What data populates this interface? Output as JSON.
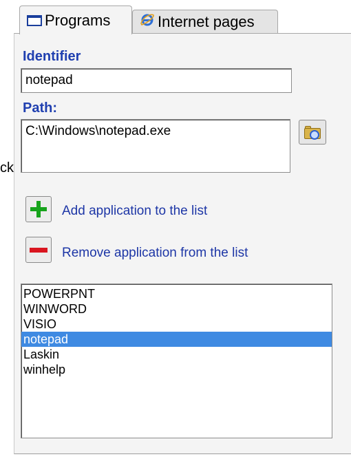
{
  "stray_text": "ck",
  "tabs": [
    {
      "label": "Programs",
      "icon": "window-icon",
      "selected": true
    },
    {
      "label": "Internet pages",
      "icon": "internet-explorer-icon",
      "selected": false
    }
  ],
  "identifier": {
    "label": "Identifier",
    "value": "notepad"
  },
  "path": {
    "label": "Path:",
    "value": "C:\\Windows\\notepad.exe",
    "browse_icon": "folder-search-icon"
  },
  "actions": {
    "add_label": "Add application to the list",
    "remove_label": "Remove application from the list"
  },
  "applications": [
    {
      "name": "POWERPNT",
      "selected": false
    },
    {
      "name": "WINWORD",
      "selected": false
    },
    {
      "name": "VISIO",
      "selected": false
    },
    {
      "name": "notepad",
      "selected": true
    },
    {
      "name": "Laskin",
      "selected": false
    },
    {
      "name": "winhelp",
      "selected": false
    }
  ],
  "colors": {
    "label_blue": "#1f3fb0",
    "selection": "#3f8ae2",
    "add_green": "#17a31c",
    "remove_red": "#d9151f"
  }
}
